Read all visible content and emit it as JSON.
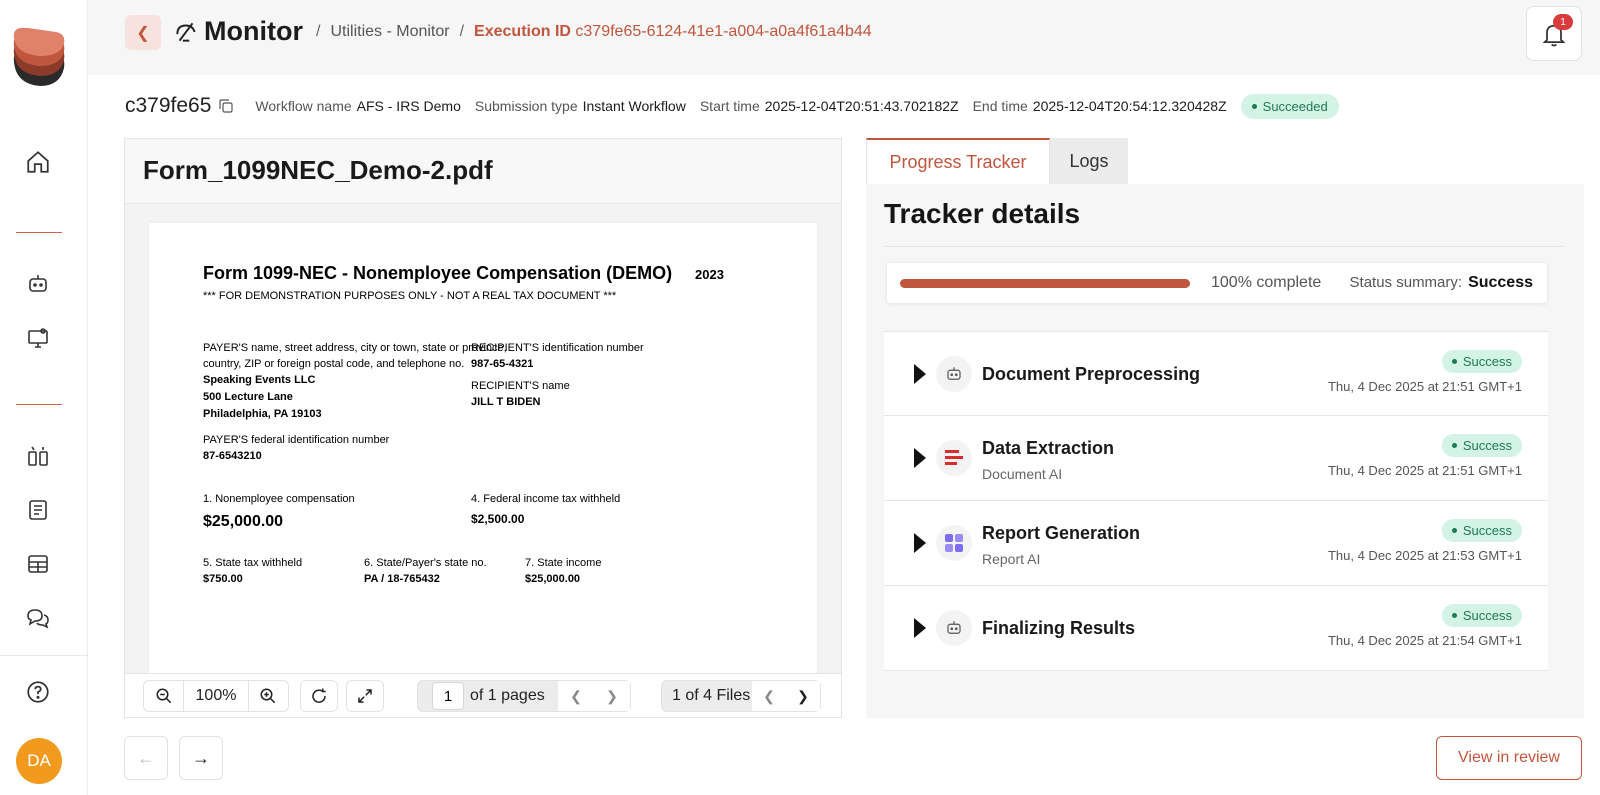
{
  "header": {
    "title": "Monitor",
    "breadcrumb": {
      "parent": "Utilities - Monitor",
      "separator": "/",
      "current_label": "Execution ID",
      "current_id": "c379fe65-6124-41e1-a004-a0a4f61a4b44"
    },
    "notifications_count": "1"
  },
  "sidebar": {
    "avatar_initials": "DA",
    "icons": [
      "home-icon",
      "bot-icon",
      "monitor-settings-icon",
      "split-view-icon",
      "document-list-icon",
      "table-icon",
      "chat-icon",
      "help-icon"
    ]
  },
  "execution": {
    "short_id": "c379fe65",
    "workflow_label": "Workflow name",
    "workflow_value": "AFS - IRS Demo",
    "submission_label": "Submission type",
    "submission_value": "Instant Workflow",
    "start_label": "Start time",
    "start_value": "2025-12-04T20:51:43.702182Z",
    "end_label": "End time",
    "end_value": "2025-12-04T20:54:12.320428Z",
    "status": "Succeeded"
  },
  "document": {
    "filename": "Form_1099NEC_Demo-2.pdf",
    "pdf": {
      "title": "Form 1099-NEC - Nonemployee Compensation (DEMO)",
      "year": "2023",
      "disclaimer": "*** FOR DEMONSTRATION PURPOSES ONLY - NOT A REAL TAX DOCUMENT ***",
      "payer_label_1": "PAYER'S name, street address, city or town, state or province,",
      "payer_label_2": "country, ZIP or foreign postal code, and telephone no.",
      "payer_name": "Speaking Events LLC",
      "payer_street": "500 Lecture Lane",
      "payer_city": "Philadelphia, PA 19103",
      "recipient_id_label": "RECIPIENT'S identification number",
      "recipient_id": "987-65-4321",
      "recipient_name_label": "RECIPIENT'S name",
      "recipient_name": "JILL T BIDEN",
      "payer_fed_label": "PAYER'S federal identification number",
      "payer_fed_id": "87-6543210",
      "box1_label": "1. Nonemployee compensation",
      "box1_value": "$25,000.00",
      "box4_label": "4. Federal income tax withheld",
      "box4_value": "$2,500.00",
      "box5_label": "5. State tax withheld",
      "box5_value": "$750.00",
      "box6_label": "6. State/Payer's state no.",
      "box6_value": "PA / 18-765432",
      "box7_label": "7. State income",
      "box7_value": "$25,000.00"
    },
    "toolbar": {
      "zoom": "100%",
      "page_current": "1",
      "page_total_label": "of 1 pages",
      "files_label": "1 of 4 Files"
    }
  },
  "tabs": [
    {
      "label": "Progress Tracker",
      "active": true
    },
    {
      "label": "Logs",
      "active": false
    }
  ],
  "tracker": {
    "title": "Tracker details",
    "progress_fraction": 1.0,
    "progress_label": "100% complete",
    "status_summary_label": "Status summary:",
    "status_summary_value": "Success",
    "steps": [
      {
        "name": "Document Preprocessing",
        "sub": "",
        "status": "Success",
        "time": "Thu, 4 Dec 2025 at 21:51 GMT+1",
        "icon": "bot-icon"
      },
      {
        "name": "Data Extraction",
        "sub": "Document AI",
        "status": "Success",
        "time": "Thu, 4 Dec 2025 at 21:51 GMT+1",
        "icon": "document-ai-icon"
      },
      {
        "name": "Report Generation",
        "sub": "Report AI",
        "status": "Success",
        "time": "Thu, 4 Dec 2025 at 21:53 GMT+1",
        "icon": "report-ai-icon"
      },
      {
        "name": "Finalizing Results",
        "sub": "",
        "status": "Success",
        "time": "Thu, 4 Dec 2025 at 21:54 GMT+1",
        "icon": "bot-icon"
      }
    ]
  },
  "footer": {
    "review_label": "View in review"
  },
  "colors": {
    "accent": "#c0563d",
    "success_bg": "#d3f3e6",
    "success_text": "#1e7a53",
    "avatar": "#f29a1e"
  }
}
